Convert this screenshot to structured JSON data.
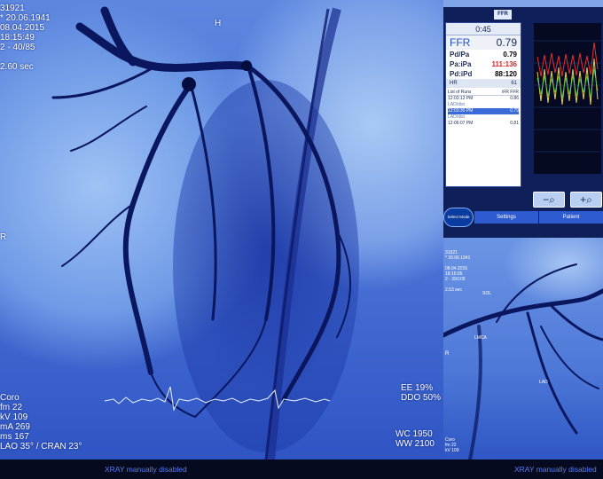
{
  "main_view": {
    "patient_lines": "31921\n* 20.06.1941\n08.04.2015\n18:15:49\n2 - 40/85\n\n2.60 sec",
    "orientation_top": "H",
    "orientation_left": "R",
    "acq_lines": "Coro\nfm 22\nkV 109\nmA 269\nms 167\nLAO 35° / CRAN 23°",
    "ee_lines": "EE 19%\nDDO 50%",
    "wc_lines": "WC 1950\nWW 2100",
    "status_text": "XRAY manually disabled"
  },
  "ffr_panel": {
    "logo": "FFR",
    "timer": "0:45",
    "ffr_label": "FFR",
    "ffr_value": "0.79",
    "pressures": [
      {
        "label": "Pd/Pa",
        "value": "0.79"
      },
      {
        "label": "Pa:iPa",
        "value": "111:136"
      },
      {
        "label": "Pd:iPd",
        "value": "88:120"
      }
    ],
    "hr_label": "HR",
    "hr_value": "61",
    "runs_header": {
      "title": "List of Runs",
      "col1": "iFR",
      "col2": "FFR"
    },
    "runs": [
      {
        "time": "12:03:12 PM",
        "ifr": "",
        "ffr": "0.86"
      },
      {
        "time": "LAD/dist",
        "ifr": "",
        "ffr": ""
      },
      {
        "time": "12:03:30 PM",
        "ifr": "",
        "ffr": "0.79"
      },
      {
        "time": "LAD/dist",
        "ifr": "",
        "ffr": ""
      },
      {
        "time": "12:06:07 PM",
        "ifr": "",
        "ffr": "0.81"
      }
    ],
    "zoom_out_icon": "zoom-out-icon",
    "zoom_in_icon": "zoom-in-icon",
    "select_label": "Select Mode",
    "tabs": [
      "Settings",
      "Patient"
    ]
  },
  "mini_view": {
    "info_lines": "31921\n* 20.06.1941\n\n08.04.2015\n18:15:05\n2 - 39/105\n\n2.53 sec",
    "orientation_left": "R",
    "label_sol": "SOL",
    "label_lmca": "LMCA",
    "label_lad": "LAD",
    "corner_lines": "Coro\nfm 22\nkV 109",
    "status_text": "XRAY manually disabled"
  },
  "colors": {
    "accent": "#2f5bd0",
    "pressure_alert": "#e02020",
    "ffr_trace_yellow": "#e8d040",
    "ffr_trace_red": "#e03030",
    "ffr_trace_green": "#40c060"
  }
}
